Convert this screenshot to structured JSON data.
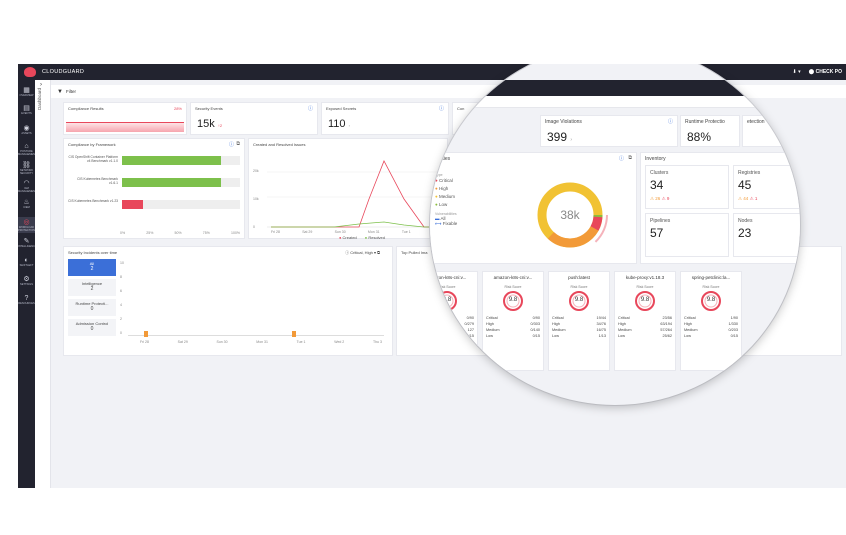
{
  "app": {
    "brand": "CLOUDGUARD",
    "check_label": "CHECK PO",
    "dashboard_tab": "Dashboard"
  },
  "filter": {
    "label": "Filter"
  },
  "sidebar": [
    {
      "icon": "grid-icon",
      "label": "OVERVIEW"
    },
    {
      "icon": "events-icon",
      "label": "EVENTS"
    },
    {
      "icon": "assets-icon",
      "label": "ASSETS"
    },
    {
      "icon": "posture-icon",
      "label": "POSTURE MANAGEMENT"
    },
    {
      "icon": "network-icon",
      "label": "NETWORK SECURITY"
    },
    {
      "icon": "iam-icon",
      "label": "IAM MANAGEMENT"
    },
    {
      "icon": "ciem-icon",
      "label": "CIEM"
    },
    {
      "icon": "workload-icon",
      "label": "WORKLOAD PROTECTION"
    },
    {
      "icon": "intelligence-icon",
      "label": "INTELLIGENCE"
    },
    {
      "icon": "shiftleft-icon",
      "label": "SHIFTLEFT"
    },
    {
      "icon": "settings-icon",
      "label": "SETTINGS"
    },
    {
      "icon": "resources-icon",
      "label": "RESOURCES"
    }
  ],
  "top_cards": {
    "compliance": {
      "title": "Compliance Results",
      "pct": "28%"
    },
    "security_events": {
      "title": "Security Events",
      "value": "15k",
      "delta": "2"
    },
    "exposed_secrets": {
      "title": "Exposed Secrets",
      "value": "110"
    },
    "image_violations": {
      "title": "Image Violations",
      "value": "399"
    },
    "runtime": {
      "title": "Runtime Protectio",
      "value": "88%"
    },
    "detection": {
      "title": "etection"
    },
    "clear_all": "Clear All",
    "feedback": "Feedback",
    "conn_short": "Con"
  },
  "compliance_framework": {
    "title": "Compliance by Framework",
    "rows": [
      {
        "label": "CIS OpenShift Container Platform v4 Benchmark v1.1.0",
        "value": 0.84,
        "color": "#7dc04b"
      },
      {
        "label": "CIS Kubernetes Benchmark v1.6.1",
        "value": 0.84,
        "color": "#7dc04b"
      },
      {
        "label": "CIS Kubernetes Benchmark v1.23",
        "value": 0.18,
        "color": "#e8475b"
      }
    ],
    "ticks": [
      "0%",
      "25%",
      "50%",
      "75%",
      "100%"
    ]
  },
  "created_resolved": {
    "title": "Created and Resolved Issues",
    "yticks": [
      "20k",
      "10k",
      "0"
    ],
    "xticks": [
      "Fri 28",
      "Sat 29",
      "Sun 30",
      "Mon 31",
      "Tue 1",
      "Wed 2"
    ],
    "legend": [
      "Created",
      "Resolved"
    ]
  },
  "incidents": {
    "title": "Security Incidents over time",
    "filter": "Critical, High",
    "types": [
      {
        "name": "All",
        "count": "2"
      },
      {
        "name": "Intelligence",
        "count": "2"
      },
      {
        "name": "Runtime Protecti...",
        "count": "0"
      },
      {
        "name": "Admission Control",
        "count": "0"
      }
    ],
    "yticks": [
      "10",
      "8",
      "6",
      "4",
      "2",
      "0"
    ],
    "xticks": [
      "Fri 28",
      "Sat 29",
      "Sun 30",
      "Mon 31",
      "Tue 1",
      "Wed 2",
      "Thu 3"
    ]
  },
  "vulnerabilities": {
    "title": "erabilities",
    "center": "38k",
    "legend_type_label": "Type",
    "types": [
      {
        "name": "Critical",
        "color": "#e8475b"
      },
      {
        "name": "High",
        "color": "#f29a38"
      },
      {
        "name": "Medium",
        "color": "#f1c233"
      },
      {
        "name": "Low",
        "color": "#8bbd3e"
      }
    ],
    "vuln_label": "Vulnerabilities",
    "all_label": "All",
    "fixable_label": "Fixable",
    "arc_labels": [
      "1k",
      "2k",
      "18k",
      "9k",
      "4k"
    ]
  },
  "inventory": {
    "title": "Inventory",
    "tiles": [
      {
        "label": "Clusters",
        "value": "34",
        "a": "26",
        "b": "9"
      },
      {
        "label": "Registries",
        "value": "45",
        "a": "44",
        "b": "1"
      },
      {
        "label": "Pipelines",
        "value": "57"
      },
      {
        "label": "Nodes",
        "value": "23"
      }
    ],
    "extra": "ries"
  },
  "top_images": {
    "title": "Top Pulled Ima",
    "risk_label": "Risk Score",
    "images": [
      {
        "name": "amazon-k8s-cni:v...",
        "score": "9.8",
        "rows": [
          [
            "",
            "0/90"
          ],
          [
            "",
            "0/279"
          ],
          [
            "",
            "127"
          ],
          [
            "",
            "0/15"
          ]
        ]
      },
      {
        "name": "amazon-k8s-cni:v...",
        "score": "9.8",
        "rows": [
          [
            "Critical",
            "0/90"
          ],
          [
            "High",
            "0/303"
          ],
          [
            "Medium",
            "0/140"
          ],
          [
            "Low",
            "0/15"
          ]
        ]
      },
      {
        "name": "push:latest",
        "score": "9.8",
        "rows": [
          [
            "Critical",
            "19/44"
          ],
          [
            "High",
            "34/76"
          ],
          [
            "Medium",
            "16/75"
          ],
          [
            "Low",
            "1/13"
          ]
        ]
      },
      {
        "name": "kube-proxy:v1.18.3",
        "score": "9.8",
        "rows": [
          [
            "Critical",
            "23/56"
          ],
          [
            "High",
            "63/194"
          ],
          [
            "Medium",
            "57/264"
          ],
          [
            "Low",
            "25/62"
          ]
        ]
      },
      {
        "name": "spring-petclinic:la...",
        "score": "9.8",
        "rows": [
          [
            "Critical",
            "1/90"
          ],
          [
            "High",
            "1/330"
          ],
          [
            "Medium",
            "0/203"
          ],
          [
            "Low",
            "0/15"
          ]
        ]
      }
    ],
    "extra_rows": [
      "0/90",
      "1/330",
      "0/203",
      "0/15"
    ]
  }
}
